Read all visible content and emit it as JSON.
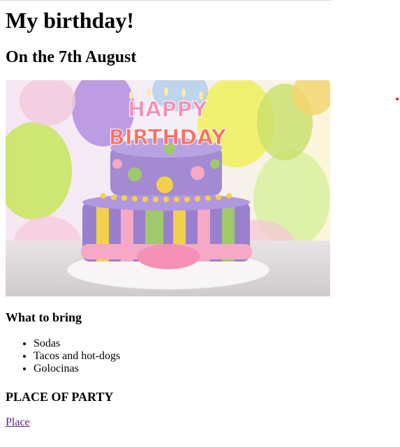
{
  "page": {
    "title": "My birthday!",
    "subtitle": "On the 7th August"
  },
  "image": {
    "alt": "Birthday cake with Happy Birthday candles",
    "candle_text_top": "HAPPY",
    "candle_text_bottom": "BIRTHDAY"
  },
  "bring": {
    "heading": "What to bring",
    "items": [
      "Sodas",
      "Tacos and hot-dogs",
      "Golocinas"
    ]
  },
  "place": {
    "heading": "PLACE OF PARTY",
    "link_label": "Place"
  },
  "colors": {
    "link_visited": "#551a8b",
    "cake_purple": "#9b7fcf",
    "cake_yellow": "#f2d04a",
    "cake_green": "#9fc96a",
    "cake_pink": "#f5a9c6"
  }
}
